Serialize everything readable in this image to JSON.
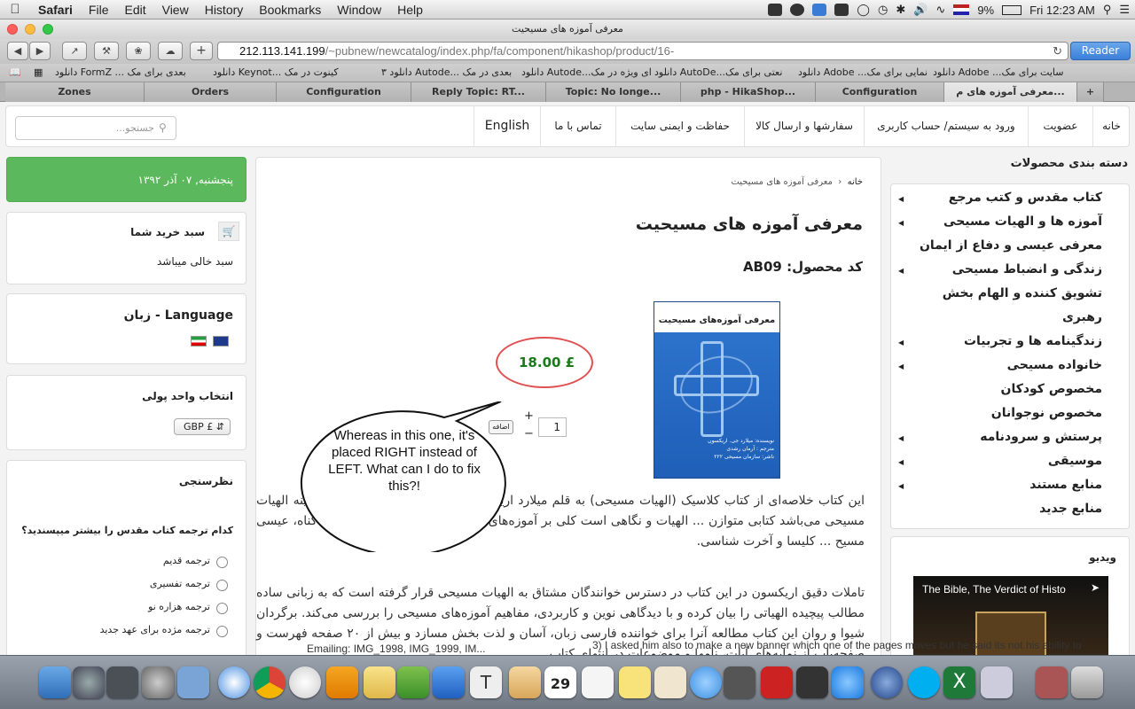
{
  "menubar": {
    "app": "Safari",
    "items": [
      "File",
      "Edit",
      "View",
      "History",
      "Bookmarks",
      "Window",
      "Help"
    ],
    "battery": "9%",
    "clock": "Fri 12:23 AM"
  },
  "window": {
    "title": "معرفی آموزه های مسیحیت"
  },
  "toolbar": {
    "address_host": "212.113.141.199",
    "address_path": "/~pubnew/newcatalog/index.php/fa/component/hikashop/product/16-",
    "reader": "Reader"
  },
  "bookmarks": [
    "دانلود Adobe ...سایت برای مک",
    "دانلود Adobe ...نمایی برای مک",
    "دانلود AutoDe...نعتی برای مک",
    "دانلود Autode...ای ویژه در مک",
    "دانلود ۳ Autode... بعدی در مک",
    "دانلود Keynot... کینوت در مک",
    "دانلود FormZ ... بعدی برای مک"
  ],
  "tabs": [
    "Zones",
    "Orders",
    "Configuration",
    "Reply Topic: RT...",
    "Topic: No longe...",
    "php - HikaShop...",
    "Configuration",
    "معرفی آموزه های م..."
  ],
  "nav": {
    "items": [
      "خانه",
      "عضویت",
      "ورود به سیستم/ حساب کاربری",
      "سفارشها و ارسال کالا",
      "حفاظت و ایمنی سایت",
      "تماس با ما",
      "English"
    ],
    "search_placeholder": "جستجو..."
  },
  "left": {
    "date": "پنجشنبه, ۰۷ آذر ۱۳۹۲",
    "cart_title": "سبد خرید شما",
    "cart_empty": "سبد خالی میباشد",
    "language_title": "زبان - Language",
    "currency_title": "انتخاب واحد پولی",
    "currency_value": "GBP £",
    "poll_title": "نظرسنجی",
    "poll_question": "کدام ترجمه کتاب مقدس را بیشتر میپسندید؟",
    "poll_options": [
      "ترجمه قدیم",
      "ترجمه تفسیری",
      "ترجمه هزاره نو",
      "ترجمه مژده برای عهد جدید"
    ]
  },
  "product": {
    "breadcrumb_home": "خانه",
    "breadcrumb_current": "معرفی آموزه های مسیحیت",
    "title": "معرفی آموزه های مسیحیت",
    "code_label": "کد محصول: AB09",
    "price": "18.00 £",
    "quantity": "1",
    "add_button": "اضافه",
    "book_title": "معرفی آموزه‌های مسیحیت",
    "book_author": "نویسنده: میلارد جی. اریکسون",
    "book_translator": "مترجم : آرمان رشدی",
    "book_publisher": "ناشر: سازمان مسیحی ۲۲۲",
    "desc1": "این کتاب خلاصه‌ای از کتاب کلاسیک (الهیات مسیحی) به قلم میلارد اریکسون ... نویسنده آثار بسیاری در زمینه الهیات مسیحی می‌باشد کتابی متوازن ... الهیات و نگاهی است کلی بر آموزه‌های مکاشفه، خدا، آفرینش، بشریت، گناه، عیسی مسیح ... کلیسا و آخرت شناسی.",
    "desc2": "تاملات دقیق اریکسون در این کتاب در دسترس خوانندگان مشتاق به الهیات مسیحی قرار گرفته است که به زبانی ساده مطالب پیچیده الهیاتی را بیان کرده و با دیدگاهی نوین و کاربردی، مفاهیم آموزه‌های مسیحی را بررسی می‌کند. برگردان شیوا و روان این کتاب مطالعه آنرا برای خواننده فارسی زبان، آسان و لذت بخش مسازد و بیش از ۲۰ صفحه فهرست و صفحه‌یاب از نمایه‌های آیات، نامها و موضوعات در انتهای کتاب..."
  },
  "callout": "Whereas in this one, it's placed RIGHT instead of LEFT. What can I do to fix this?!",
  "categories": {
    "title": "دسته بندی محصولات",
    "items": [
      "کتاب مقدس و کتب مرجع",
      "آموزه ها و الهیات مسیحی",
      "معرفی عیسی و دفاع از ایمان",
      "زندگی و انضباط مسیحی",
      "تشویق کننده و الهام بخش",
      "رهبری",
      "زندگینامه ها و تجربیات",
      "خانواده مسیحی",
      "مخصوص کودکان",
      "مخصوص نوجوانان",
      "پرستش و سرودنامه",
      "موسیقی",
      "منابع مستند",
      "منابع جدید"
    ],
    "arrows": [
      true,
      true,
      false,
      true,
      false,
      false,
      true,
      true,
      false,
      false,
      true,
      true,
      true,
      false
    ]
  },
  "video": {
    "title": "ویدیو",
    "caption": "The Bible, The Verdict of Histo"
  },
  "overlay": {
    "chat_left": "Emailing: IMG_1998, IMG_1999, IM...",
    "chat_right": "3) I asked him also to make a new banner which one of the pages moves but he said its not his ability to",
    "dock_date": "29"
  },
  "colors": {
    "price": "#1a7a1a",
    "green": "#5cb85c",
    "callout_ring": "#e05050"
  }
}
